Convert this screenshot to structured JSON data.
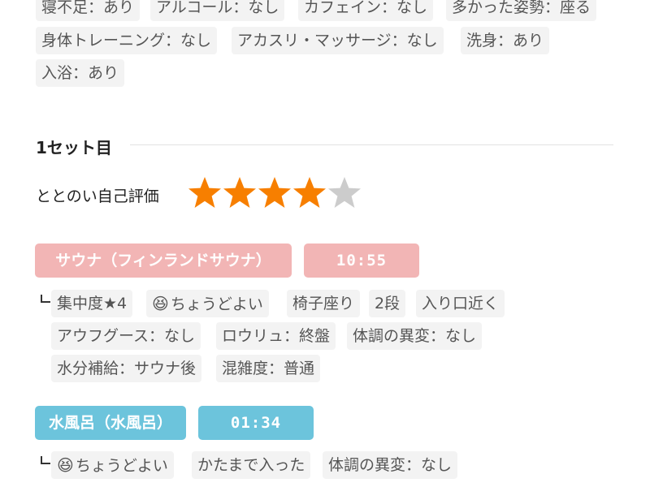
{
  "conditions": [
    "寝不足：あり",
    "アルコール：なし",
    "カフェイン：なし",
    "多かった姿勢：座る",
    "身体トレーニング：なし",
    "アカスリ・マッサージ：なし",
    "洗身：あり",
    "入浴：あり"
  ],
  "set1": {
    "title": "1セット目",
    "rating_label": "ととのい自己評価",
    "rating": 4,
    "rating_max": 5,
    "sauna": {
      "name": "サウナ（フィンランドサウナ）",
      "time": "10:55",
      "tags": [
        "集中度★4",
        "ちょうどよい",
        "椅子座り",
        "2段",
        "入り口近く",
        "アウフグース：なし",
        "ロウリュ：終盤",
        "体調の異変：なし",
        "水分補給：サウナ後",
        "混雑度：普通"
      ]
    },
    "water": {
      "name": "水風呂（水風呂）",
      "time": "01:34",
      "tags": [
        "ちょうどよい",
        "かたまで入った",
        "体調の異変：なし"
      ]
    }
  },
  "colors": {
    "star_on": "#f77f00",
    "star_off": "#cccccc",
    "sauna": "#f2b5b5",
    "water": "#6cc4dc"
  },
  "icons": {
    "smile": "😆"
  }
}
